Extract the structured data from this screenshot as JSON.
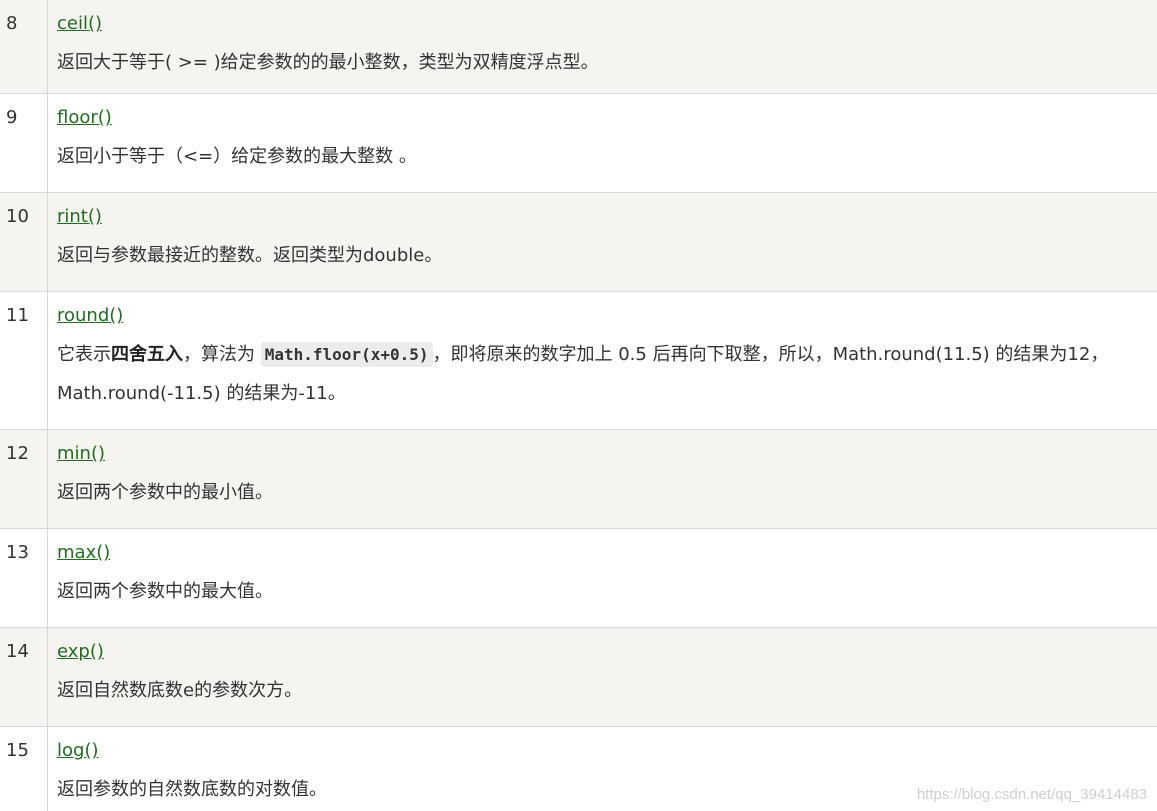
{
  "rows": [
    {
      "num": "8",
      "method": "ceil()",
      "desc": "返回大于等于( >= )给定参数的的最小整数，类型为双精度浮点型。"
    },
    {
      "num": "9",
      "method": "floor()",
      "desc": "返回小于等于（<=）给定参数的最大整数 。"
    },
    {
      "num": "10",
      "method": "rint()",
      "desc": "返回与参数最接近的整数。返回类型为double。"
    },
    {
      "num": "11",
      "method": "round()",
      "desc_prefix": "它表示",
      "desc_bold": "四舍五入",
      "desc_mid": "，算法为 ",
      "desc_code": "Math.floor(x+0.5)",
      "desc_suffix": "，即将原来的数字加上 0.5 后再向下取整，所以，Math.round(11.5) 的结果为12，",
      "desc_line2": "Math.round(-11.5) 的结果为-11。"
    },
    {
      "num": "12",
      "method": "min()",
      "desc": "返回两个参数中的最小值。"
    },
    {
      "num": "13",
      "method": "max()",
      "desc": "返回两个参数中的最大值。"
    },
    {
      "num": "14",
      "method": "exp()",
      "desc": "返回自然数底数e的参数次方。"
    },
    {
      "num": "15",
      "method": "log()",
      "desc": "返回参数的自然数底数的对数值。"
    }
  ],
  "watermark": "https://blog.csdn.net/qq_39414483"
}
